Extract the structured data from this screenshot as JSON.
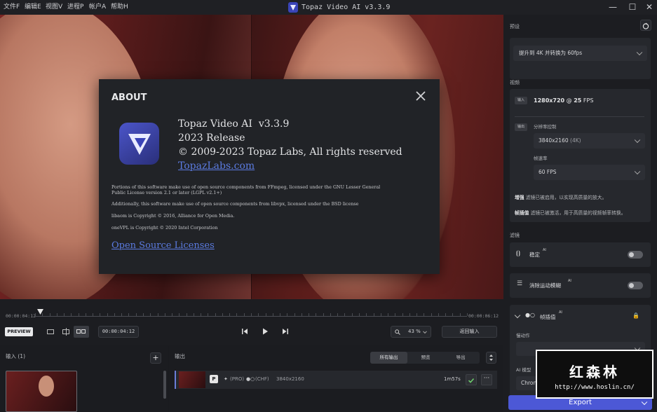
{
  "menu": [
    "文件F",
    "编辑E",
    "视图V",
    "进程P",
    "帐户A",
    "帮助H"
  ],
  "app_title": "Topaz Video AI  v3.3.9",
  "window_controls": {
    "minimize": "—",
    "maximize": "☐",
    "close": "✕"
  },
  "about": {
    "title": "ABOUT",
    "product_line": "Topaz Video AI  v3.3.9",
    "release": "2023 Release",
    "copyright": "© 2009-2023 Topaz Labs, All rights reserved",
    "link": "TopazLabs.com",
    "notice1": "Portions of this software make use of open source components from FFmpeg, licensed under the GNU Lesser General",
    "notice1b": "Public License version 2.1 or later (LGPL v2.1+)",
    "notice2": "Additionally, this software make use of open source components from libvpx, licensed under the BSD license",
    "notice3": "libaom is Copyright © 2016, Alliance for Open Media.",
    "notice4": "oneVPL is Copyright © 2020 Intel Corporation",
    "oss_link": "Open Source Licenses"
  },
  "timeline": {
    "start_time": "00:00:04:12",
    "end_time": "00:00:06:12",
    "current_time": "00:00:04:12",
    "preview_label": "PREVIEW",
    "zoom": "43 %",
    "return_label": "返回输入"
  },
  "inputs": {
    "label": "输入 (1)",
    "add": "+"
  },
  "outputs": {
    "label": "输出",
    "tabs": [
      "所有输出",
      "预览",
      "导出"
    ],
    "row": {
      "badge": "P",
      "pro": "(PRO)",
      "chf": "(CHF)",
      "resolution": "3840x2160",
      "duration": "1m57s"
    }
  },
  "right": {
    "preset_label": "预设",
    "preset_value": "提升到 4K 并转换为 60fps",
    "video_label": "视频",
    "input_tag": "输入",
    "input_res": "1280x720",
    "input_at": "@",
    "input_fps": "25",
    "input_fps_unit": "FPS",
    "output_tag": "输出",
    "res_control_label": "分辨率控制",
    "res_value": "3840x2160",
    "res_note": "(4K)",
    "fps_label": "帧速率",
    "fps_value": "60 FPS",
    "enhance_title": "增强",
    "enhance_text": "滤镜已被启用，以实现高质量的放大。",
    "interp_title": "帧插值",
    "interp_text": "滤镜已被激活，用于高质量的视频帧率转换。",
    "filters_label": "滤镜",
    "stabilize": "稳定",
    "deblur": "消除运动模糊",
    "frame_interp": "帧插值",
    "ai_sup": "AI",
    "motion_label": "慢动作",
    "ai_model_label": "AI 模型",
    "ai_model_value": "Chronos Fast",
    "export_label": "Export"
  },
  "watermark": {
    "title": "红森林",
    "url": "http://www.hoslin.cn/"
  }
}
